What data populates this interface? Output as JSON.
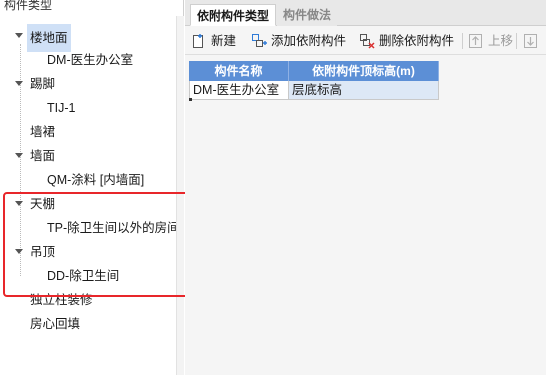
{
  "left_panel": {
    "header": "构件类型",
    "tree": [
      {
        "id": "floor",
        "label": "楼地面",
        "level": 0,
        "expanded": true,
        "selected": true
      },
      {
        "id": "floor-child",
        "label": "DM-医生办公室",
        "level": 1
      },
      {
        "id": "skirting",
        "label": "踢脚",
        "level": 0,
        "expanded": true
      },
      {
        "id": "skirting-child",
        "label": "TIJ-1",
        "level": 1
      },
      {
        "id": "dado",
        "label": "墙裙",
        "level": 0
      },
      {
        "id": "wall",
        "label": "墙面",
        "level": 0,
        "expanded": true
      },
      {
        "id": "wall-child",
        "label": "QM-涂料 [内墙面]",
        "level": 1
      },
      {
        "id": "ceiling",
        "label": "天棚",
        "level": 0,
        "expanded": true
      },
      {
        "id": "ceiling-child",
        "label": "TP-除卫生间以外的房间",
        "level": 1
      },
      {
        "id": "suspended",
        "label": "吊顶",
        "level": 0,
        "expanded": true
      },
      {
        "id": "suspended-child",
        "label": "DD-除卫生间",
        "level": 1
      },
      {
        "id": "column",
        "label": "独立柱装修",
        "level": 0
      },
      {
        "id": "room-fill",
        "label": "房心回填",
        "level": 0
      }
    ]
  },
  "right_panel": {
    "tabs": [
      {
        "label": "依附构件类型",
        "active": true
      },
      {
        "label": "构件做法",
        "active": false
      }
    ],
    "toolbar": {
      "new_label": "新建",
      "add_label": "添加依附构件",
      "delete_label": "删除依附构件",
      "up_label": "上移"
    },
    "grid": {
      "columns": [
        "构件名称",
        "依附构件顶标高(m)"
      ],
      "rows": [
        {
          "name": "DM-医生办公室",
          "elevation": "层底标高"
        }
      ]
    }
  },
  "colors": {
    "highlight": "#e8262a",
    "grid_header": "#5c8fd6",
    "selection": "#cfe0f6"
  }
}
